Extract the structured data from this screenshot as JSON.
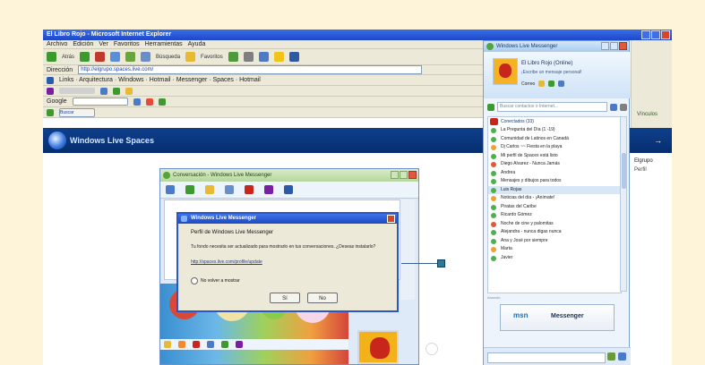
{
  "ie": {
    "title": "El Libro Rojo - Microsoft Internet Explorer",
    "menu": [
      "Archivo",
      "Edición",
      "Ver",
      "Favoritos",
      "Herramientas",
      "Ayuda"
    ],
    "toolbar": {
      "back_label": "Atrás",
      "search_label": "Búsqueda",
      "favorites_label": "Favoritos"
    },
    "address": {
      "label": "Dirección",
      "value": "http://elgrupo.spaces.live.com/"
    },
    "links_row": "Links · Arquitectura · Windows · Hotmail · Messenger · Spaces · Hotmail",
    "google_label": "Google",
    "tab_label": "Buscar",
    "right_strip_label": "Vínculos"
  },
  "spaces": {
    "title": "Windows Live Spaces",
    "side_text": "Elgrupo",
    "side_text2": "Perfil"
  },
  "chat": {
    "title": "Conversación - Windows Live Messenger"
  },
  "dialog": {
    "title": "Windows Live Messenger",
    "heading": "Perfil de Windows Live Messenger",
    "text": "Tu fondo necesita ser actualizado para mostrarlo en tus conversaciones. ¿Deseas instalarlo?",
    "link": "http://spaces.live.com/profile/update",
    "checkbox_label": "No volver a mostrar",
    "ok_label": "Sí",
    "no_label": "No"
  },
  "msn": {
    "title": "Windows Live Messenger",
    "display_name": "El Libro Rojo (Online)",
    "personal_message": "¡Escribe un mensaje personal!",
    "status_label": "Correo",
    "search_placeholder": "Buscar contactos o Internet...",
    "group_label": "Conectados (33)",
    "contacts": [
      "La Pregunta del Día (1 -19)",
      "Comunidad de Latinos en Canadá",
      "Dj Carlos ~~ Fiesta en la playa",
      "Mi perfil de Spaces está listo",
      "Diego Alvarez - Nunca Jamás",
      "Andrea",
      "Mensajes y dibujos para todos",
      "Luis Rojas",
      "Noticias del día - ¡Anímate!",
      "Piratas del Caribe",
      "Ricardo Gómez",
      "Noche de cine y palomitas",
      "Alejandra - nunca digas nunca",
      "Ana y José por siempre",
      "Marta",
      "Javier"
    ],
    "ad_label": "Anuncio",
    "ad_brand": "msn",
    "ad_text": "Messenger"
  },
  "colors": {
    "accent": "#1d47c8",
    "messenger_blue": "#7aa0cf",
    "devil_red": "#c8251b"
  }
}
